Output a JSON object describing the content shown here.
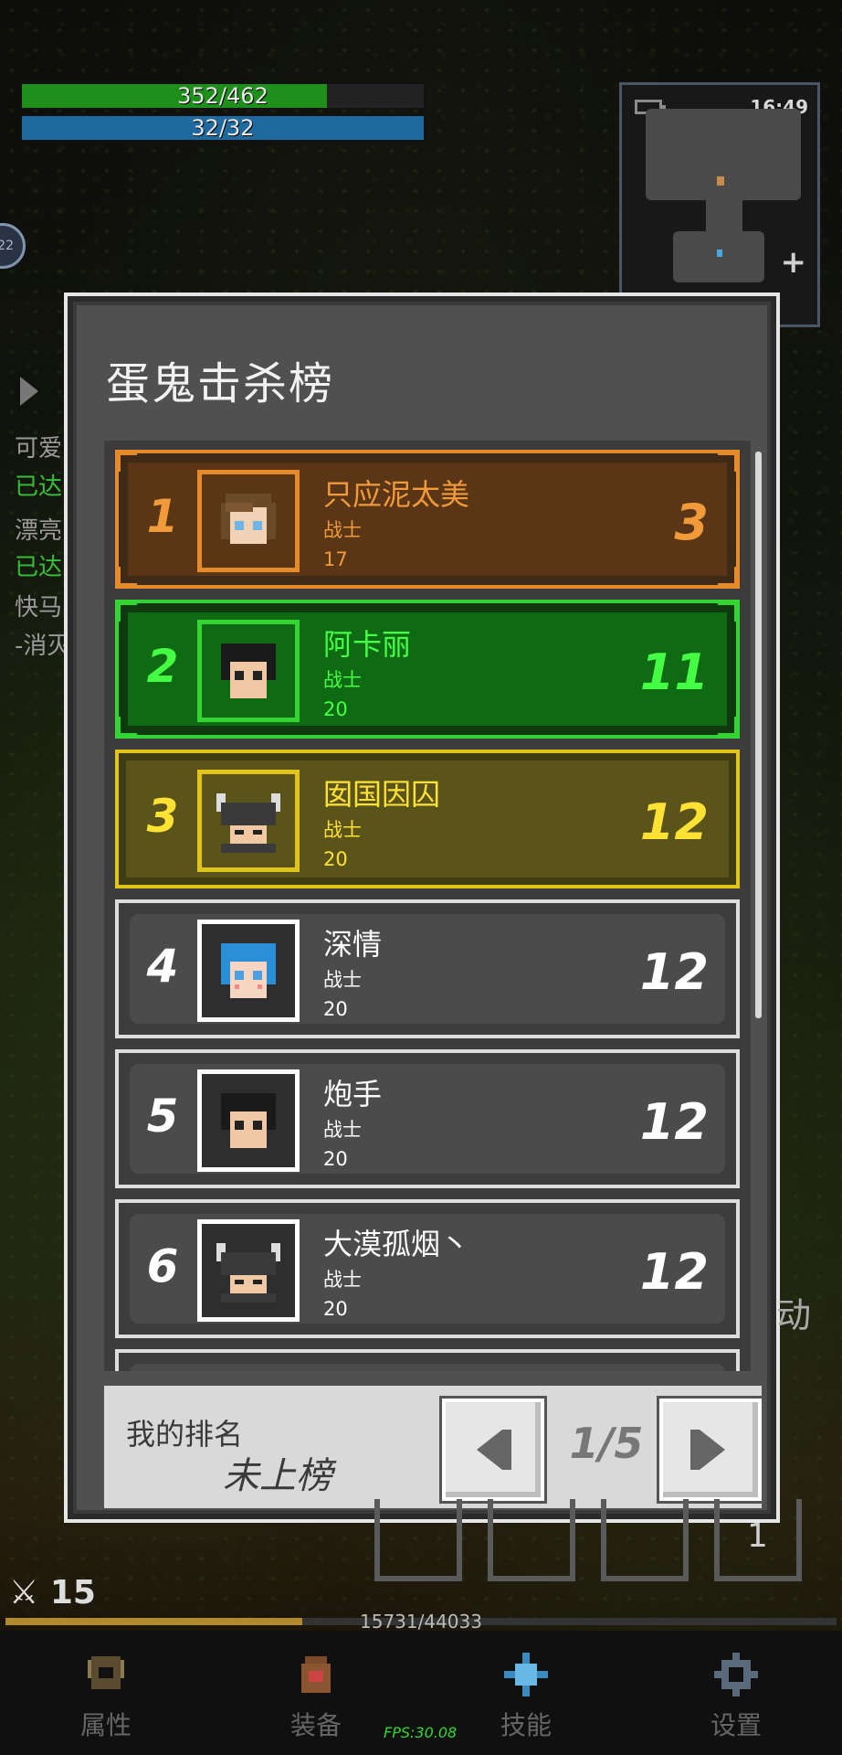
{
  "hud": {
    "hp": "352/462",
    "hp_fraction": 0.76,
    "mp": "32/32",
    "side_lines": [
      "可爱",
      "已达",
      "漂亮",
      "已达",
      "快马",
      "-消灭"
    ],
    "buff_number": "22"
  },
  "minimap": {
    "time": "16:49",
    "plus": "+"
  },
  "dialog": {
    "title": "蛋鬼击杀榜",
    "entries": [
      {
        "rank": "1",
        "name": "只应泥太美",
        "class": "战士",
        "level": "17",
        "kills": "3"
      },
      {
        "rank": "2",
        "name": "阿卡丽",
        "class": "战士",
        "level": "20",
        "kills": "11"
      },
      {
        "rank": "3",
        "name": "囡国因囚",
        "class": "战士",
        "level": "20",
        "kills": "12"
      },
      {
        "rank": "4",
        "name": "深情",
        "class": "战士",
        "level": "20",
        "kills": "12"
      },
      {
        "rank": "5",
        "name": "炮手",
        "class": "战士",
        "level": "20",
        "kills": "12"
      },
      {
        "rank": "6",
        "name": "大漠孤烟丶",
        "class": "战士",
        "level": "20",
        "kills": "12"
      }
    ],
    "my_rank_label": "我的排名",
    "my_rank_value": "未上榜",
    "page": "1/5"
  },
  "bottom": {
    "attack_count": "15",
    "slot_number": "1",
    "side_right": "动",
    "xp_text": "15731/44033",
    "xp_fraction": 0.357,
    "nav": {
      "attributes": "属性",
      "equipment": "装备",
      "skills": "技能",
      "settings": "设置"
    },
    "fps": "FPS:30.08"
  }
}
